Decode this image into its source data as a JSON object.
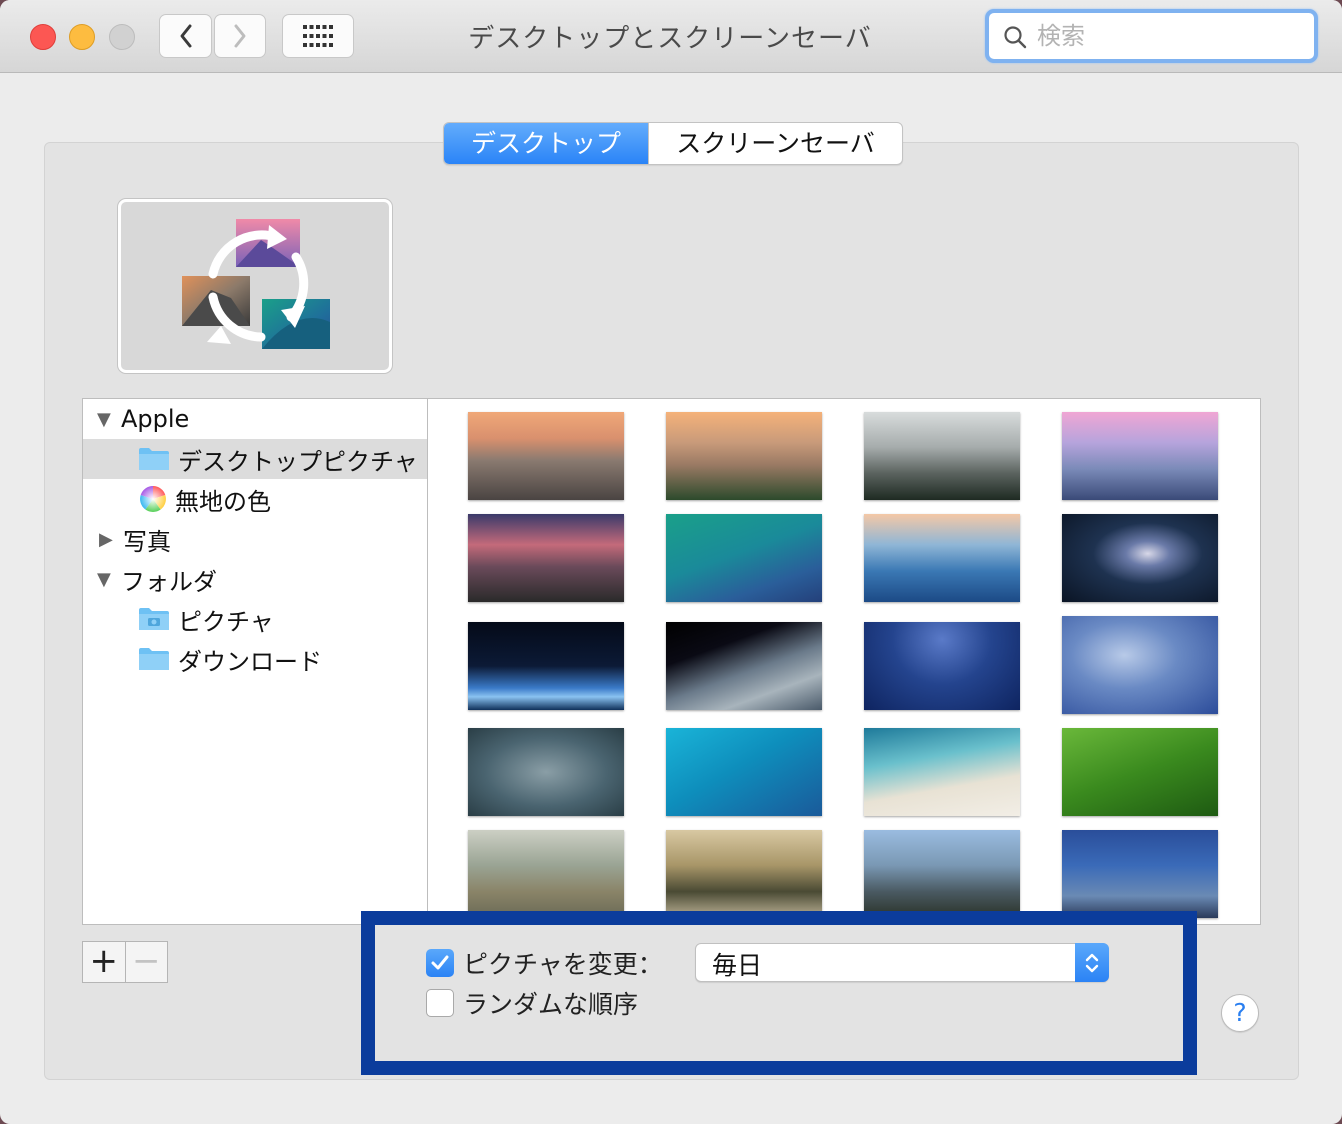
{
  "window": {
    "title": "デスクトップとスクリーンセーバ",
    "search_placeholder": "検索",
    "nav_back_glyph": "‹",
    "nav_forward_glyph": "›"
  },
  "tabs": [
    {
      "label": "デスクトップ",
      "active": true
    },
    {
      "label": "スクリーンセーバ",
      "active": false
    }
  ],
  "preview": {
    "icon": "rotating-wallpapers-icon"
  },
  "sidebar": {
    "items": [
      {
        "label": "Apple",
        "expanded": true,
        "icon": "triangle-down"
      },
      {
        "label": "デスクトップピクチャ",
        "selected": true,
        "icon": "folder-icon"
      },
      {
        "label": "無地の色",
        "icon": "color-wheel-icon"
      },
      {
        "label": "写真",
        "expanded": false,
        "icon": "triangle-right"
      },
      {
        "label": "フォルダ",
        "expanded": true,
        "icon": "triangle-down"
      },
      {
        "label": "ピクチャ",
        "icon": "pictures-folder-icon"
      },
      {
        "label": "ダウンロード",
        "icon": "folder-icon"
      }
    ]
  },
  "wallpapers": [
    {
      "name": "yosemite-half-dome-sunset"
    },
    {
      "name": "el-capitan-sunset"
    },
    {
      "name": "yosemite-valley-fog"
    },
    {
      "name": "half-dome-pink-sky"
    },
    {
      "name": "lake-rocks-dusk"
    },
    {
      "name": "green-wave"
    },
    {
      "name": "blue-wave"
    },
    {
      "name": "galaxy"
    },
    {
      "name": "earth-moon-horizon"
    },
    {
      "name": "earth-from-orbit"
    },
    {
      "name": "milky-way-blue"
    },
    {
      "name": "clouds-moon"
    },
    {
      "name": "storm-clouds"
    },
    {
      "name": "turquoise-sea"
    },
    {
      "name": "beach-shore"
    },
    {
      "name": "green-fields"
    },
    {
      "name": "autumn-fog"
    },
    {
      "name": "forest-sunrays"
    },
    {
      "name": "misty-mountains"
    },
    {
      "name": "blue-sky-horizon"
    }
  ],
  "controls": {
    "add": "+",
    "remove": "−",
    "change_picture_label": "ピクチャを変更：",
    "change_picture_checked": true,
    "interval_value": "毎日",
    "random_order_label": "ランダムな順序",
    "random_order_checked": false,
    "help": "?"
  },
  "colors": {
    "accent": "#2b83f5",
    "highlight_frame": "#0b3c9c"
  }
}
